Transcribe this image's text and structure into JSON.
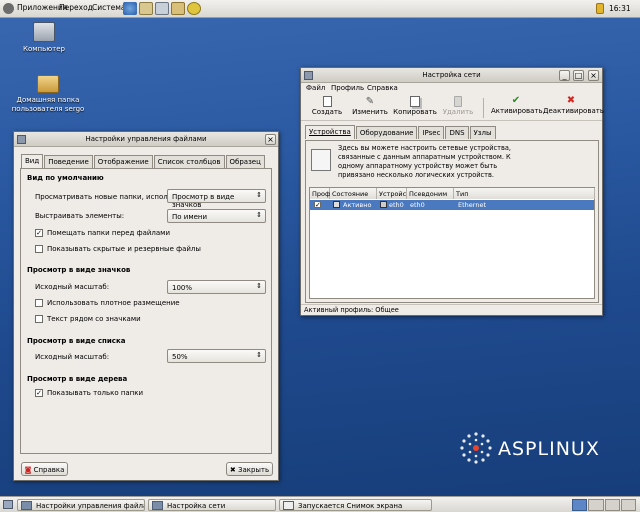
{
  "top_panel": {
    "menu": [
      "Приложения",
      "Переход",
      "Система"
    ],
    "clock": "16:31"
  },
  "desktop": {
    "icons": [
      {
        "label": "Компьютер"
      },
      {
        "label_line1": "Домашняя папка",
        "label_line2": "пользователя sergo"
      }
    ],
    "logo_text": "ASPLINUX"
  },
  "net_window": {
    "title": "Настройка сети",
    "menu": [
      "Файл",
      "Профиль",
      "Справка"
    ],
    "toolbar": [
      {
        "label": "Создать",
        "icon": "new-icon"
      },
      {
        "label": "Изменить",
        "icon": "wrench-icon"
      },
      {
        "label": "Копировать",
        "icon": "copy-icon"
      },
      {
        "label": "Удалить",
        "icon": "trash-icon"
      },
      {
        "label": "Активировать",
        "icon": "check-icon"
      },
      {
        "label": "Деактивировать",
        "icon": "x-icon"
      }
    ],
    "tabs": [
      "Устройства",
      "Оборудование",
      "IPsec",
      "DNS",
      "Узлы"
    ],
    "info_line1": "Здесь вы можете настроить сетевые устройства,",
    "info_line2": "связанные с данным аппаратным устройством. К",
    "info_line3": "одному аппаратному устройству может быть",
    "info_line4": "привязано несколько логических устройств.",
    "columns": [
      "Проф",
      "Состояние",
      "Устройс",
      "Псевдоним",
      "Тип"
    ],
    "row": {
      "status": "Активно",
      "device": "eth0",
      "alias": "eth0",
      "type": "Ethernet"
    },
    "status": "Активный профиль: Общее"
  },
  "fm_window": {
    "title": "Настройки управления файлами",
    "tabs": [
      "Вид",
      "Поведение",
      "Отображение",
      "Список столбцов",
      "Образец"
    ],
    "sec1": "Вид по умолчанию",
    "view_label": "Просматривать новые папки, используя:",
    "view_value": "Просмотр в виде значков",
    "arrange_label": "Выстраивать элементы:",
    "arrange_value": "По имени",
    "chk_folders_first": "Помещать папки перед файлами",
    "chk_hidden": "Показывать скрытые и резервные файлы",
    "sec2": "Просмотр в виде значков",
    "icon_zoom_label": "Исходный масштаб:",
    "icon_zoom_value": "100%",
    "chk_compact": "Использовать плотное размещение",
    "chk_text_beside": "Текст рядом со значками",
    "sec3": "Просмотр в виде списка",
    "list_zoom_label": "Исходный масштаб:",
    "list_zoom_value": "50%",
    "sec4": "Просмотр в виде дерева",
    "chk_only_folders": "Показывать только папки",
    "help": "Справка",
    "close": "Закрыть"
  },
  "taskbar": [
    "Настройки управления файлами",
    "Настройка сети",
    "Запускается Снимок экрана"
  ],
  "colors": {
    "selection": "#4a79c0",
    "desktop": "#2b5aa3"
  }
}
